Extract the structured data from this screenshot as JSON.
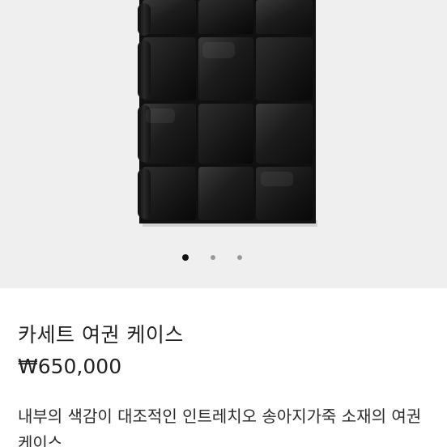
{
  "gallery": {
    "image_alt": "카세트 여권 케이스",
    "slide_count": 3,
    "active_slide": 1,
    "colors": {
      "background": "#efefef",
      "active_dot": "#111111",
      "inactive_dot": "#9a9a9a"
    }
  },
  "product": {
    "name": "카세트 여권 케이스",
    "price": "₩650,000",
    "description": "내부의 색감이 대조적인 인트레치오 송아지가죽 소재의 여권 케이스"
  }
}
